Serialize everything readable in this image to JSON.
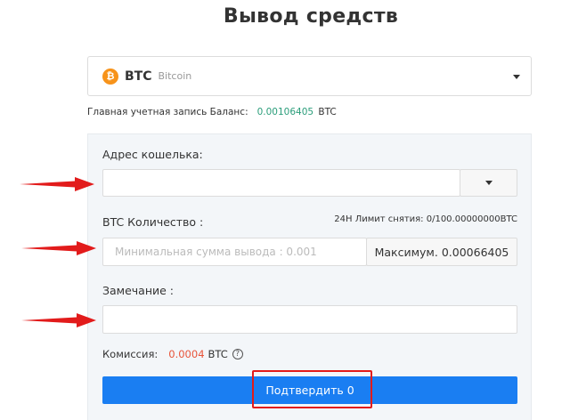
{
  "page": {
    "title": "Вывод средств"
  },
  "coin": {
    "icon_glyph": "₿",
    "symbol": "BTC",
    "name": "Bitcoin",
    "icon_color": "#f7931a"
  },
  "balance": {
    "label": "Главная учетная запись Баланс:",
    "value": "0.00106405",
    "unit": "BTC"
  },
  "form": {
    "address_label": "Адрес кошелька:",
    "amount_label": "BTC Количество :",
    "limit_text": "24H Лимит снятия: 0/100.00000000BTC",
    "amount_placeholder": "Минимальная сумма вывода : 0.001",
    "max_label": "Максимум.",
    "max_value": "0.00066405",
    "note_label": "Замечание :",
    "fee_label": "Комиссия:",
    "fee_value": "0.0004",
    "fee_unit": "BTC",
    "help_glyph": "?",
    "submit_label": "Подтвердить 0"
  },
  "colors": {
    "accent": "#1a7ef2",
    "fee": "#e8543a",
    "balance": "#2a9d7a",
    "annotation": "#e21b1b"
  }
}
